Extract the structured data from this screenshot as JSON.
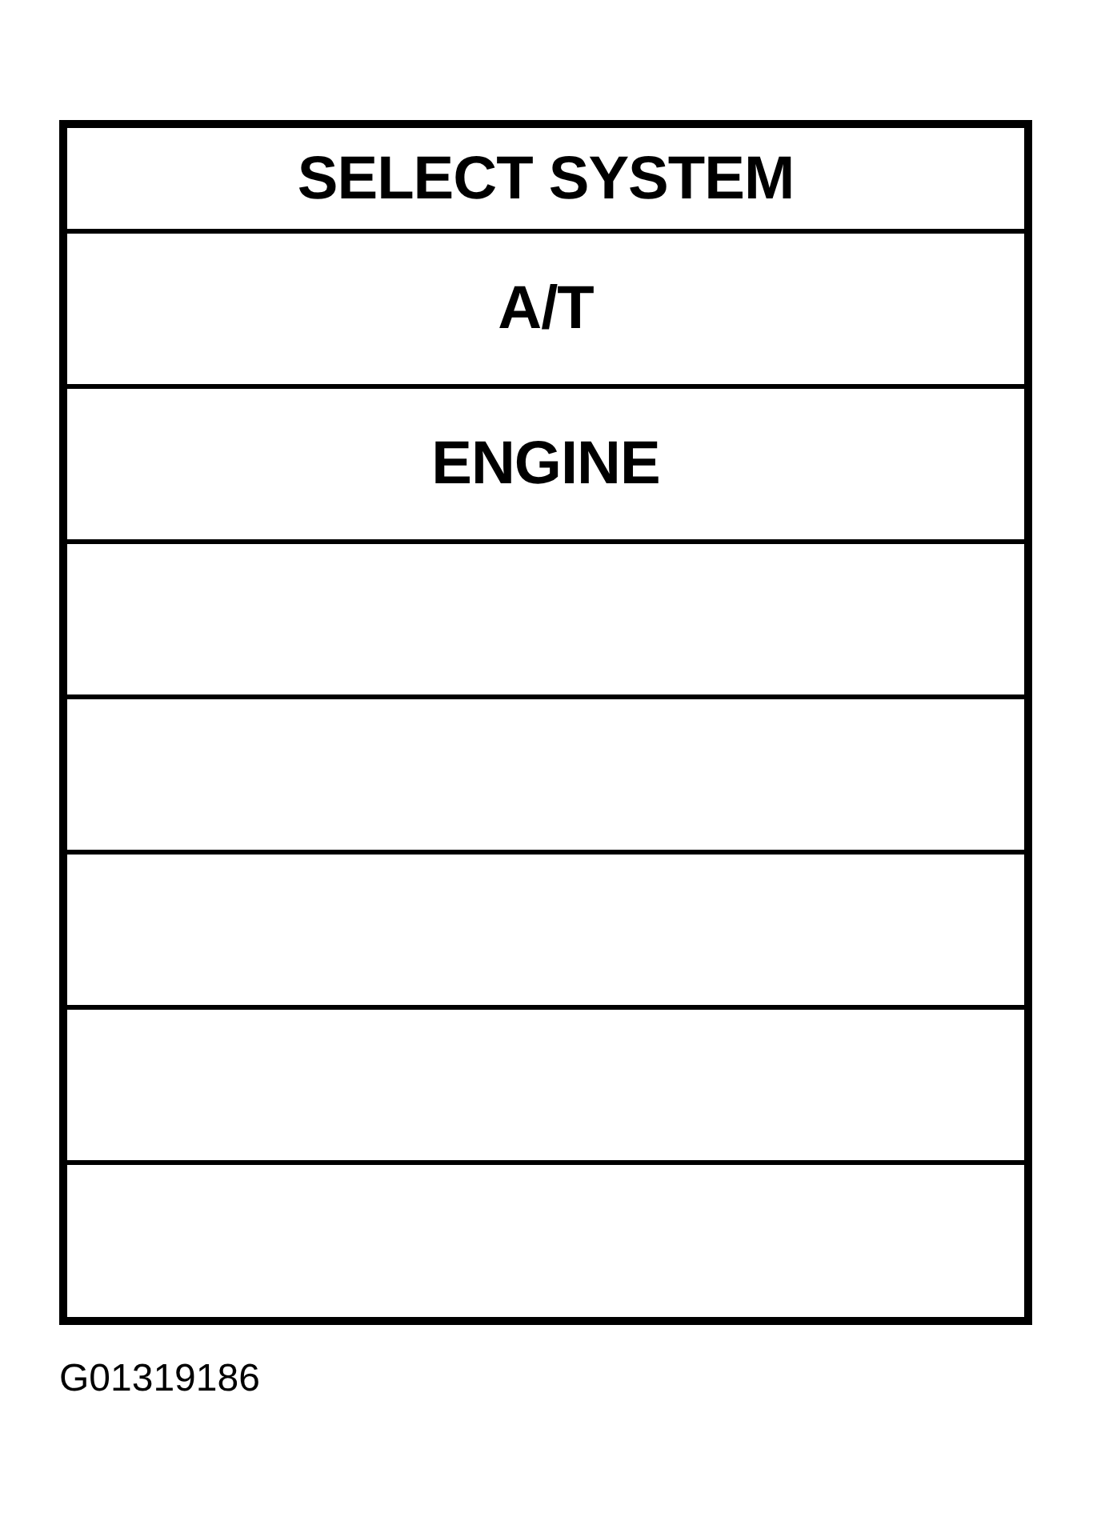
{
  "menu": {
    "title": "SELECT SYSTEM",
    "items": [
      {
        "kind": "option",
        "label": "A/T"
      },
      {
        "kind": "option",
        "label": "ENGINE"
      },
      {
        "kind": "blank"
      },
      {
        "kind": "blank"
      },
      {
        "kind": "blank"
      },
      {
        "kind": "blank"
      },
      {
        "kind": "blank"
      }
    ]
  },
  "figure_id": "G01319186"
}
